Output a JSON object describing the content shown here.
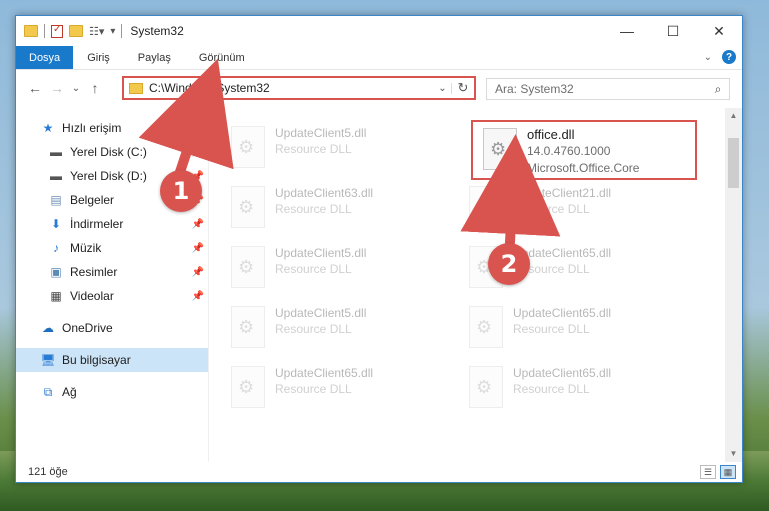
{
  "window": {
    "title": "System32",
    "controls": {
      "minimize": "—",
      "maximize": "☐",
      "close": "✕"
    }
  },
  "ribbon": {
    "tabs": [
      "Dosya",
      "Giriş",
      "Paylaş",
      "Görünüm"
    ]
  },
  "navigation": {
    "address": "C:\\Windows\\System32",
    "search_placeholder": "Ara: System32"
  },
  "sidebar": {
    "quick_access": "Hızlı erişim",
    "items": [
      {
        "label": "Yerel Disk (C:)",
        "icon": "drive-icon"
      },
      {
        "label": "Yerel Disk (D:)",
        "icon": "drive-icon"
      },
      {
        "label": "Belgeler",
        "icon": "documents-icon"
      },
      {
        "label": "İndirmeler",
        "icon": "download-icon"
      },
      {
        "label": "Müzik",
        "icon": "music-icon"
      },
      {
        "label": "Resimler",
        "icon": "pictures-icon"
      },
      {
        "label": "Videolar",
        "icon": "videos-icon"
      }
    ],
    "onedrive": "OneDrive",
    "this_pc": "Bu bilgisayar",
    "network": "Ağ"
  },
  "files": {
    "column_left": [
      {
        "name": "UpdateClient5.dll",
        "desc": "Resource DLL"
      },
      {
        "name": "UpdateClient63.dll",
        "desc": "Resource DLL"
      },
      {
        "name": "UpdateClient5.dll",
        "desc": "Resource DLL"
      },
      {
        "name": "UpdateClient5.dll",
        "desc": "Resource DLL"
      },
      {
        "name": "UpdateClient65.dll",
        "desc": "Resource DLL"
      }
    ],
    "column_right": [
      {
        "name": "UpdateClient21.dll",
        "desc": "Resource DLL"
      },
      {
        "name": "UpdateClient65.dll",
        "desc": "Resource DLL"
      },
      {
        "name": "UpdateClient65.dll",
        "desc": "Resource DLL"
      },
      {
        "name": "UpdateClient65.dll",
        "desc": "Resource DLL"
      }
    ],
    "highlighted": {
      "name": "office.dll",
      "version": "14.0.4760.1000",
      "description": "Microsoft.Office.Core"
    }
  },
  "status": {
    "item_count": "121 öğe"
  },
  "annotations": {
    "badge1": "1",
    "badge2": "2",
    "color": "#d9534f"
  }
}
